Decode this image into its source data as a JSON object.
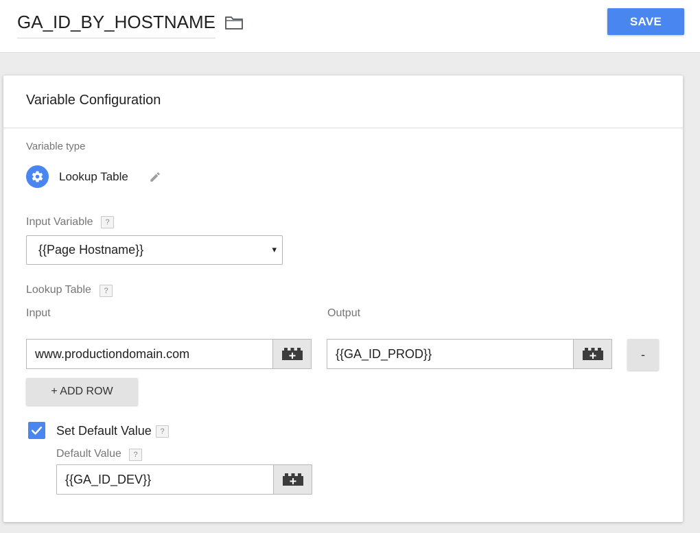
{
  "header": {
    "title": "GA_ID_BY_HOSTNAME",
    "folder_icon": "folder-icon",
    "save_label": "SAVE",
    "accent_color": "#4a86f0"
  },
  "card": {
    "title": "Variable Configuration",
    "variable_type_label": "Variable type",
    "variable_type_icon": "gear-icon",
    "variable_type_name": "Lookup Table",
    "edit_icon": "pencil-icon",
    "input_variable": {
      "label": "Input Variable",
      "help": "?",
      "selected": "{{Page Hostname}}",
      "arrow": "▾"
    },
    "lookup_table": {
      "label": "Lookup Table",
      "help": "?",
      "input_header": "Input",
      "output_header": "Output",
      "rows": [
        {
          "input": "www.productiondomain.com",
          "output": "{{GA_ID_PROD}}",
          "remove_label": "-"
        }
      ],
      "add_row_label": "+ ADD ROW"
    },
    "default_value": {
      "checkbox_label": "Set Default Value",
      "checked": true,
      "help": "?",
      "field_label": "Default Value",
      "field_help": "?",
      "value": "{{GA_ID_DEV}}"
    },
    "picker_icon": "variable-picker-icon"
  }
}
